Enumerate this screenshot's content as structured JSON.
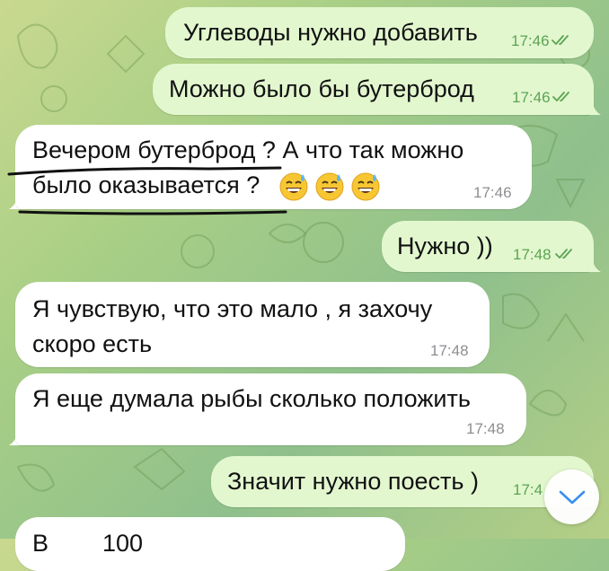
{
  "colors": {
    "outgoing_bubble": "#e3f7cf",
    "incoming_bubble": "#ffffff",
    "outgoing_time": "#5ba453",
    "incoming_time": "#8e8e93",
    "scroll_arrow": "#3a8ef0",
    "annotation_ink": "#111111"
  },
  "messages": [
    {
      "direction": "outgoing",
      "text": "Углеводы нужно добавить",
      "time": "17:46",
      "status": "read"
    },
    {
      "direction": "outgoing",
      "text": "Можно было бы бутерброд",
      "time": "17:46",
      "status": "read"
    },
    {
      "direction": "incoming",
      "line1": "Вечером бутерброд ? А что так можно",
      "line2": "было оказывается ?",
      "emojis": [
        "grinning-sweat-emoji",
        "grinning-sweat-emoji",
        "grinning-sweat-emoji"
      ],
      "time": "17:46"
    },
    {
      "direction": "outgoing",
      "text": "Нужно ))",
      "time": "17:48",
      "status": "read"
    },
    {
      "direction": "incoming",
      "line1": "Я чувствую, что это мало , я захочу",
      "line2": "скоро есть",
      "time": "17:48"
    },
    {
      "direction": "incoming",
      "text": "Я еще думала рыбы сколько положить",
      "time": "17:48"
    },
    {
      "direction": "outgoing",
      "text": "Значит нужно поесть )",
      "time": "17:4"
    },
    {
      "direction": "incoming",
      "text": "В        100"
    }
  ],
  "scroll_button": {
    "icon": "chevron-down-icon"
  }
}
